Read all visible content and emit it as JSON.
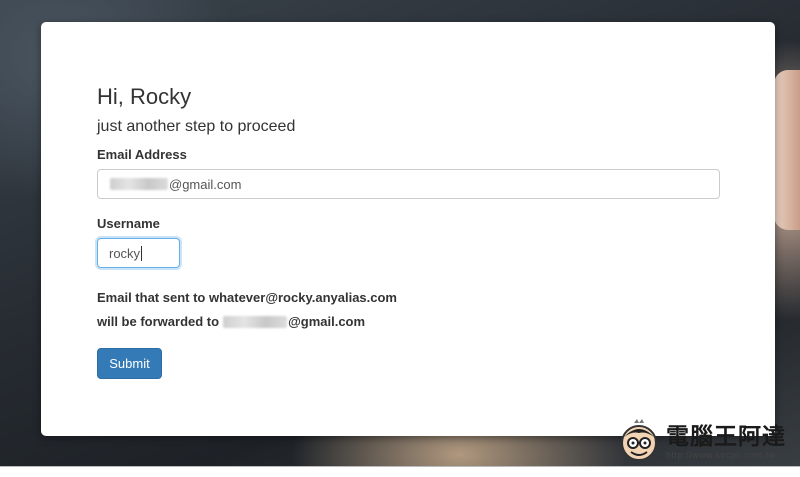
{
  "form": {
    "greeting": "Hi, Rocky",
    "subtitle": "just another step to proceed",
    "email_label": "Email Address",
    "email_value_visible": "@gmail.com",
    "username_label": "Username",
    "username_value": "rocky",
    "info_line1": "Email that sent to whatever@rocky.anyalias.com",
    "info_line2_prefix": "will be forwarded to",
    "info_line2_suffix": "@gmail.com",
    "submit_label": "Submit"
  },
  "colors": {
    "primary_button": "#337ab7",
    "focus_border": "#66afe9",
    "text": "#333333"
  },
  "watermark": {
    "title": "電腦王阿達",
    "url": "http://www.kocpc.com.tw"
  }
}
